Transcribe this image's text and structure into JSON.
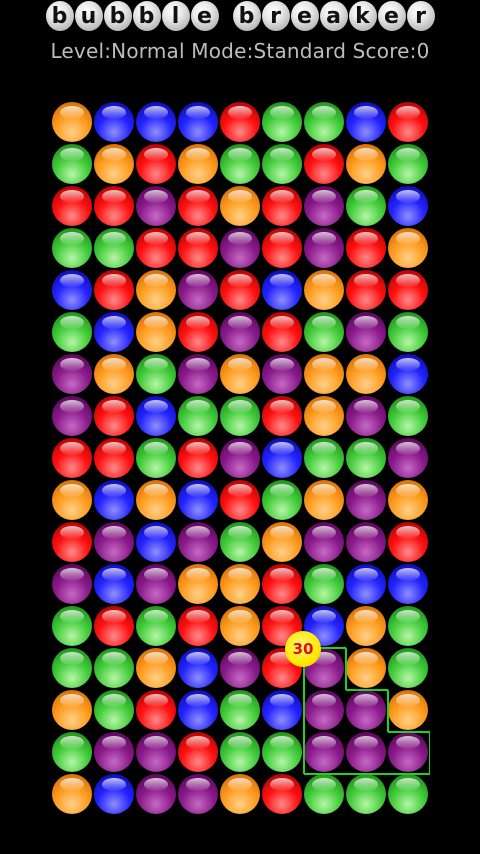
{
  "title": {
    "words": [
      [
        "b",
        "u",
        "b",
        "b",
        "l",
        "e"
      ],
      [
        "b",
        "r",
        "e",
        "a",
        "k",
        "e",
        "r"
      ]
    ]
  },
  "status": {
    "text": "Level:Normal Mode:Standard Score:0"
  },
  "colors": {
    "o": "#ff9c1e",
    "b": "#2323ff",
    "r": "#ff1010",
    "g": "#42cc3a",
    "p": "#8a1a8a",
    "selection_outline": "#21d21d",
    "score_bubble": "#ffe900"
  },
  "board": {
    "columns": 9,
    "rows": 17,
    "grid": [
      [
        "o",
        "b",
        "b",
        "b",
        "r",
        "g",
        "g",
        "b",
        "r"
      ],
      [
        "g",
        "o",
        "r",
        "o",
        "g",
        "g",
        "r",
        "o",
        "g"
      ],
      [
        "r",
        "r",
        "p",
        "r",
        "o",
        "r",
        "p",
        "g",
        "b"
      ],
      [
        "g",
        "g",
        "r",
        "r",
        "p",
        "r",
        "p",
        "r",
        "o"
      ],
      [
        "b",
        "r",
        "o",
        "p",
        "r",
        "b",
        "o",
        "r",
        "r"
      ],
      [
        "g",
        "b",
        "o",
        "r",
        "p",
        "r",
        "g",
        "p",
        "g"
      ],
      [
        "p",
        "o",
        "g",
        "p",
        "o",
        "p",
        "o",
        "o",
        "b"
      ],
      [
        "p",
        "r",
        "b",
        "g",
        "g",
        "r",
        "o",
        "p",
        "g"
      ],
      [
        "r",
        "r",
        "g",
        "r",
        "p",
        "b",
        "g",
        "g",
        "p"
      ],
      [
        "o",
        "b",
        "o",
        "b",
        "r",
        "g",
        "o",
        "p",
        "o"
      ],
      [
        "r",
        "p",
        "b",
        "p",
        "g",
        "o",
        "p",
        "p",
        "r"
      ],
      [
        "p",
        "b",
        "p",
        "o",
        "o",
        "r",
        "g",
        "b",
        "b"
      ],
      [
        "g",
        "r",
        "g",
        "r",
        "o",
        "r",
        "b",
        "o",
        "g"
      ],
      [
        "g",
        "g",
        "o",
        "b",
        "p",
        "r",
        "p",
        "o",
        "g"
      ],
      [
        "o",
        "g",
        "r",
        "b",
        "g",
        "b",
        "p",
        "p",
        "o"
      ],
      [
        "g",
        "p",
        "p",
        "r",
        "g",
        "g",
        "p",
        "p",
        "p"
      ],
      [
        "o",
        "b",
        "p",
        "p",
        "o",
        "r",
        "g",
        "g",
        "g"
      ]
    ],
    "selected_group": [
      [
        13,
        6
      ],
      [
        14,
        6
      ],
      [
        14,
        7
      ],
      [
        15,
        6
      ],
      [
        15,
        7
      ],
      [
        15,
        8
      ]
    ]
  },
  "score_popup": {
    "value": "30"
  }
}
